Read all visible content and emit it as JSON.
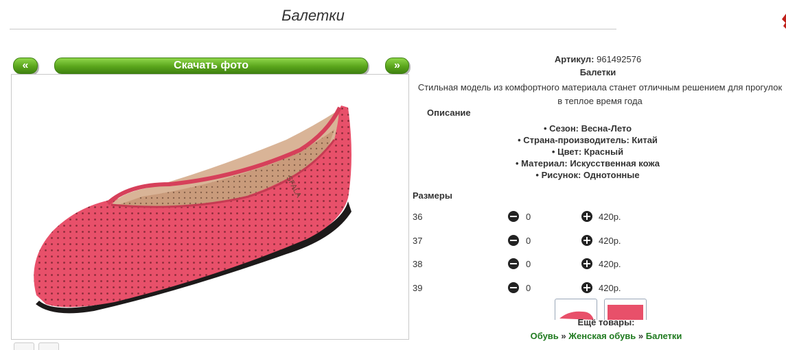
{
  "page": {
    "title": "Балетки"
  },
  "gallery": {
    "prev_label": "«",
    "download_label": "Скачать фото",
    "next_label": "»",
    "photo_icon": "pink-ballet-flat-photo",
    "shoe_color": "#e8506a"
  },
  "product": {
    "sku_label": "Артикул:",
    "sku_value": "961492576",
    "name": "Балетки",
    "description": "Стильная модель из комфортного материала станет отличным решением для прогулок в теплое время года",
    "description_heading": "Описание",
    "properties": [
      "Сезон: Весна-Лето",
      "Страна-производитель: Китай",
      "Цвет: Красный",
      "Материал: Искусственная кожа",
      "Рисунок: Однотонные"
    ]
  },
  "sizes": {
    "heading": "Размеры",
    "rows": [
      {
        "size": "36",
        "qty": "0",
        "price": "420р."
      },
      {
        "size": "37",
        "qty": "0",
        "price": "420р."
      },
      {
        "size": "38",
        "qty": "0",
        "price": "420р."
      },
      {
        "size": "39",
        "qty": "0",
        "price": "420р."
      }
    ]
  },
  "more": {
    "heading": "Ещё товары:",
    "breadcrumbs": [
      "Обувь",
      "Женская обувь",
      "Балетки"
    ],
    "separator": "»"
  },
  "colors": {
    "button_green": "#5aa51c",
    "link_green": "#1f7a1f",
    "corner_red": "#c0201a"
  }
}
